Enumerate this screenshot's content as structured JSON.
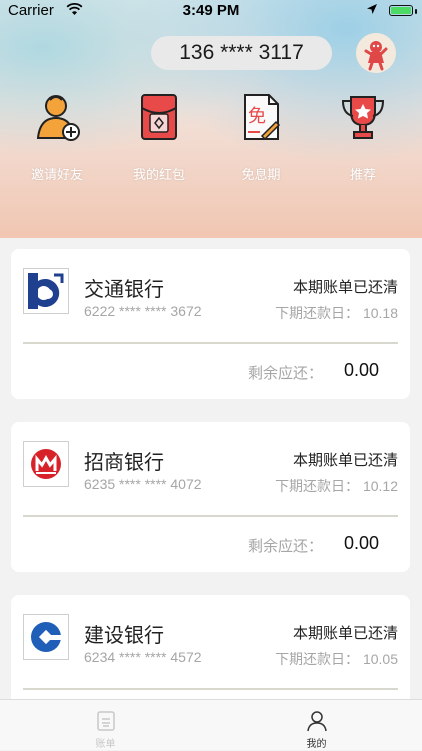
{
  "status_bar": {
    "carrier": "Carrier",
    "time": "3:49 PM"
  },
  "header": {
    "phone": "136 **** 3117"
  },
  "quick_actions": [
    {
      "label": "邀请好友",
      "icon": "invite-friend-icon"
    },
    {
      "label": "我的红包",
      "icon": "red-envelope-icon"
    },
    {
      "label": "免息期",
      "icon": "interest-free-icon"
    },
    {
      "label": "推荐",
      "icon": "trophy-icon"
    }
  ],
  "cards": [
    {
      "bank": "交通银行",
      "number": "6222 **** **** 3672",
      "status": "本期账单已还清",
      "due_label": "下期还款日：",
      "due_date": "10.18",
      "remaining_label": "剩余应还：",
      "remaining": "0.00"
    },
    {
      "bank": "招商银行",
      "number": "6235 **** **** 4072",
      "status": "本期账单已还清",
      "due_label": "下期还款日：",
      "due_date": "10.12",
      "remaining_label": "剩余应还：",
      "remaining": "0.00"
    },
    {
      "bank": "建设银行",
      "number": "6234 **** **** 4572",
      "status": "本期账单已还清",
      "due_label": "下期还款日：",
      "due_date": "10.05"
    }
  ],
  "tabbar": {
    "tabs": [
      {
        "label": "账单",
        "active": false,
        "color": "#c8c8c8"
      },
      {
        "label": "我的",
        "active": true,
        "color": "#333333"
      }
    ]
  },
  "colors": {
    "battery": "#4cd964",
    "accent_red": "#e23b3b"
  }
}
